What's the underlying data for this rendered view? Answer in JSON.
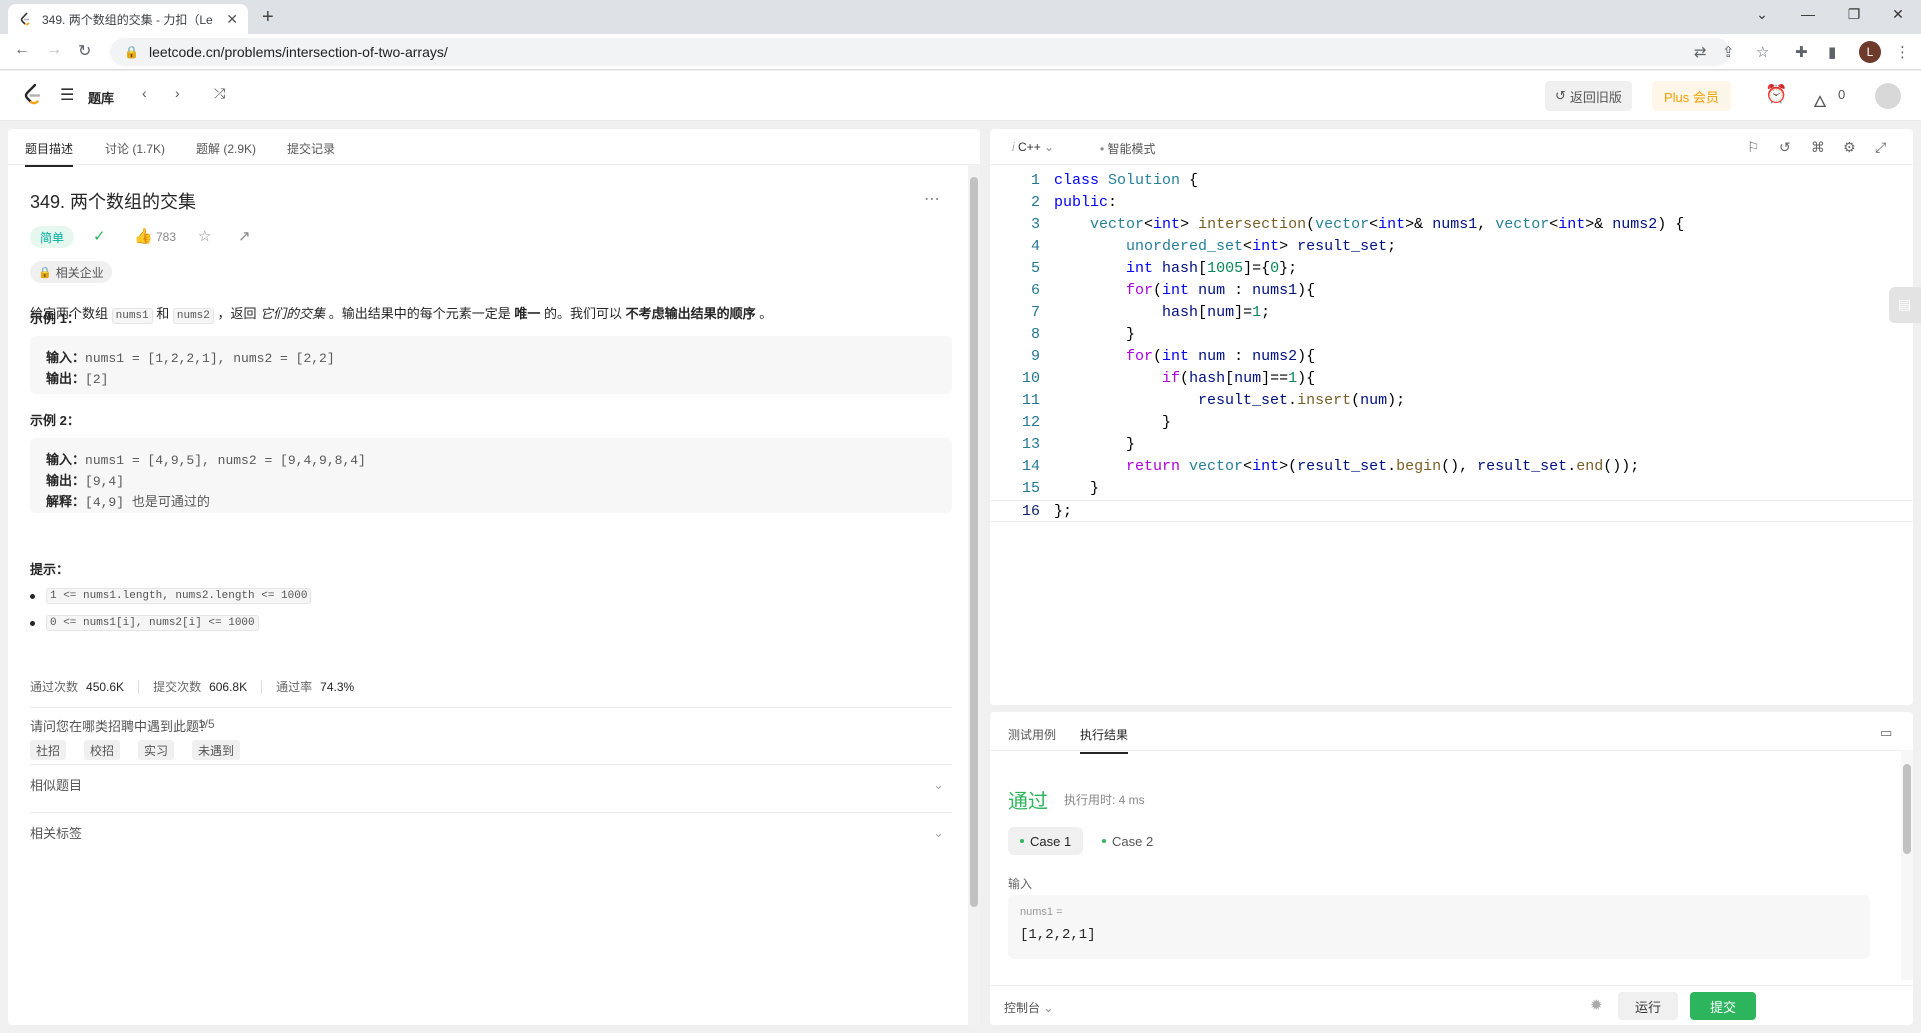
{
  "browser": {
    "tab_title": "349. 两个数组的交集 - 力扣（Le",
    "url": "leetcode.cn/problems/intersection-of-two-arrays/",
    "profile_initial": "L"
  },
  "header": {
    "problemset": "题库",
    "old_version": "返回旧版",
    "plus": "Plus 会员",
    "streak_count": "0"
  },
  "problem": {
    "tabs": [
      "题目描述",
      "讨论 (1.7K)",
      "题解 (2.9K)",
      "提交记录"
    ],
    "title": "349. 两个数组的交集",
    "difficulty": "简单",
    "likes": "783",
    "company": "相关企业",
    "desc": {
      "p1": "给定两个数组 ",
      "c1": "nums1",
      "p2": " 和 ",
      "c2": "nums2",
      "p3": " ，返回 ",
      "em": "它们的交集",
      "p4": " 。输出结果中的每个元素一定是 ",
      "b1": "唯一",
      "p5": " 的。我们可以 ",
      "b2": "不考虑输出结果的顺序",
      "p6": " 。"
    },
    "example1_title": "示例 1：",
    "example1": {
      "in_label": "输入：",
      "in_value": "nums1 = [1,2,2,1], nums2 = [2,2]",
      "out_label": "输出：",
      "out_value": "[2]"
    },
    "example2_title": "示例 2：",
    "example2": {
      "in_label": "输入：",
      "in_value": "nums1 = [4,9,5], nums2 = [9,4,9,8,4]",
      "out_label": "输出：",
      "out_value": "[9,4]",
      "exp_label": "解释：",
      "exp_value": "[4,9] 也是可通过的"
    },
    "hints_title": "提示：",
    "hints": [
      "1 <= nums1.length, nums2.length <= 1000",
      "0 <= nums1[i], nums2[i] <= 1000"
    ],
    "stats": {
      "accepted_label": "通过次数",
      "accepted": "450.6K",
      "submissions_label": "提交次数",
      "submissions": "606.8K",
      "rate_label": "通过率",
      "rate": "74.3%"
    },
    "interview": {
      "question": "请问您在哪类招聘中遇到此题？",
      "pager": "1/5",
      "options": [
        "社招",
        "校招",
        "实习",
        "未遇到"
      ]
    },
    "similar": "相似题目",
    "tags": "相关标签"
  },
  "editor": {
    "language": "C++",
    "mode": "智能模式",
    "code_lines": [
      "class Solution {",
      "public:",
      "    vector<int> intersection(vector<int>& nums1, vector<int>& nums2) {",
      "        unordered_set<int> result_set;",
      "        int hash[1005]={0};",
      "        for(int num : nums1){",
      "            hash[num]=1;",
      "        }",
      "        for(int num : nums2){",
      "            if(hash[num]==1){",
      "                result_set.insert(num);",
      "            }",
      "        }",
      "        return vector<int>(result_set.begin(), result_set.end());",
      "    }",
      "};"
    ]
  },
  "result": {
    "tabs": [
      "测试用例",
      "执行结果"
    ],
    "status": "通过",
    "runtime": "执行用时: 4 ms",
    "cases": [
      "Case 1",
      "Case 2"
    ],
    "input_label": "输入",
    "input_name": "nums1 =",
    "input_value": "[1,2,2,1]",
    "console": "控制台",
    "run": "运行",
    "submit": "提交"
  },
  "colors": {
    "accent_green": "#2db55d",
    "easy_teal": "#00af9b",
    "plus_orange": "#f59f00"
  }
}
